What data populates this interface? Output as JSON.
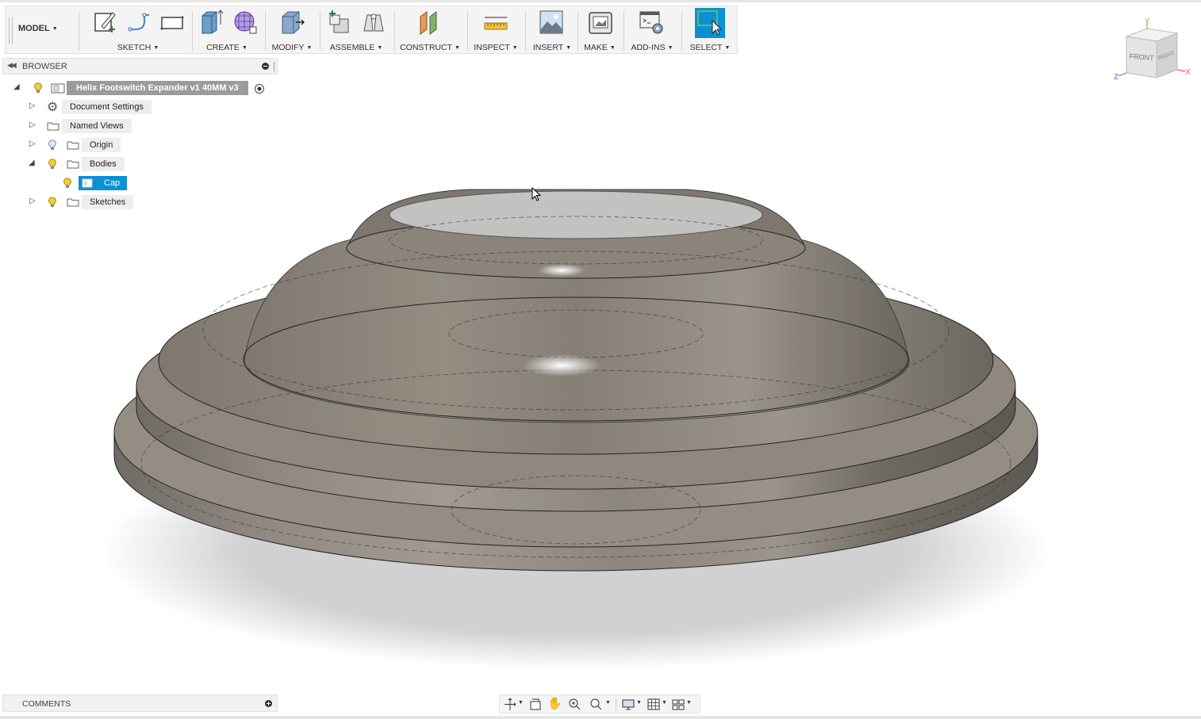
{
  "toolbar": {
    "workspace": "MODEL",
    "groups": [
      {
        "label": "SKETCH"
      },
      {
        "label": "CREATE"
      },
      {
        "label": "MODIFY"
      },
      {
        "label": "ASSEMBLE"
      },
      {
        "label": "CONSTRUCT"
      },
      {
        "label": "INSPECT"
      },
      {
        "label": "INSERT"
      },
      {
        "label": "MAKE"
      },
      {
        "label": "ADD-INS"
      },
      {
        "label": "SELECT"
      }
    ]
  },
  "browser": {
    "title": "BROWSER",
    "root": "Helix Footswitch Expander v1 40MM v3",
    "items": [
      {
        "label": "Document Settings",
        "icon": "gear-icon"
      },
      {
        "label": "Named Views",
        "icon": "folder-icon"
      },
      {
        "label": "Origin",
        "icon": "folder-icon"
      },
      {
        "label": "Bodies",
        "icon": "folder-icon",
        "expanded": true
      },
      {
        "label": "Cap",
        "icon": "body-icon",
        "selected": true
      },
      {
        "label": "Sketches",
        "icon": "folder-icon"
      }
    ]
  },
  "viewcube": {
    "faces": {
      "front": "FRONT",
      "right": "RIGHT"
    },
    "axes": {
      "x": "X",
      "y": "Y",
      "z": "Z"
    }
  },
  "comments": {
    "title": "COMMENTS"
  },
  "colors": {
    "accent": "#0a91d5",
    "panel": "#f1f1f1",
    "model": "#8f877c"
  }
}
